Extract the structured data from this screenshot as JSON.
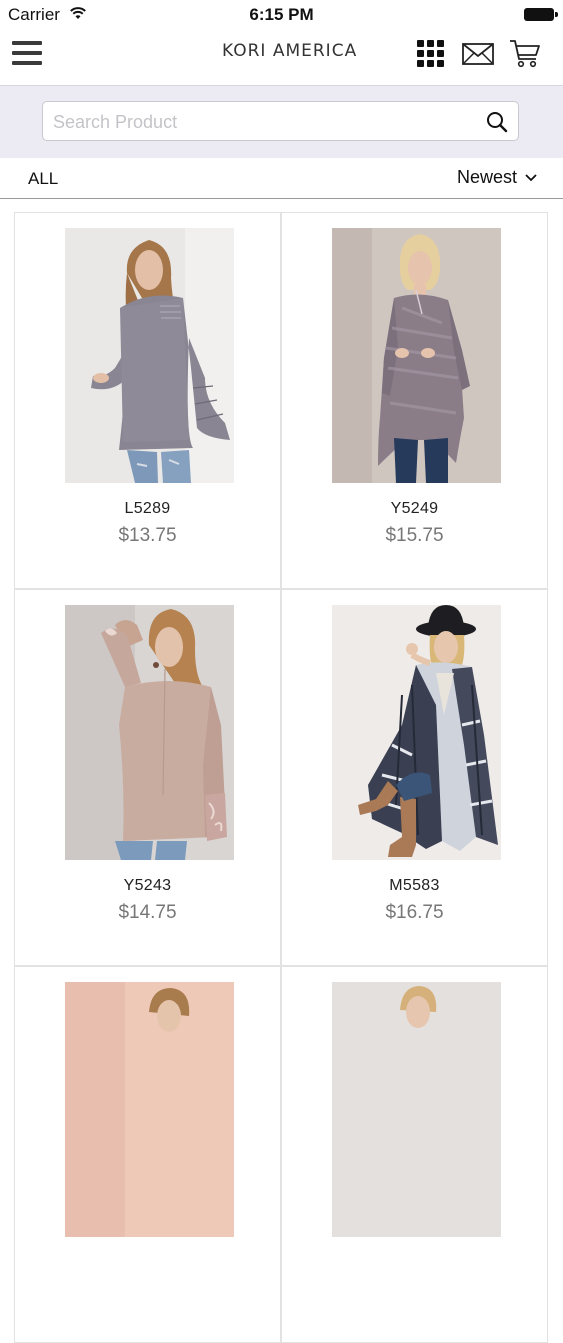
{
  "status_bar": {
    "carrier": "Carrier",
    "time": "6:15 PM"
  },
  "nav": {
    "logo": "KORI AMERICA",
    "icons": [
      "menu-icon",
      "grid-icon",
      "mail-icon",
      "cart-icon"
    ]
  },
  "search": {
    "placeholder": "Search Product",
    "value": ""
  },
  "filter": {
    "category": "ALL",
    "sort": "Newest"
  },
  "products": [
    {
      "sku": "L5289",
      "price": "$13.75"
    },
    {
      "sku": "Y5249",
      "price": "$15.75"
    },
    {
      "sku": "Y5243",
      "price": "$14.75"
    },
    {
      "sku": "M5583",
      "price": "$16.75"
    },
    {
      "sku": "",
      "price": ""
    },
    {
      "sku": "",
      "price": ""
    }
  ],
  "colors": {
    "search_bg": "#ecebf3",
    "price": "#777777",
    "text": "#222222"
  }
}
